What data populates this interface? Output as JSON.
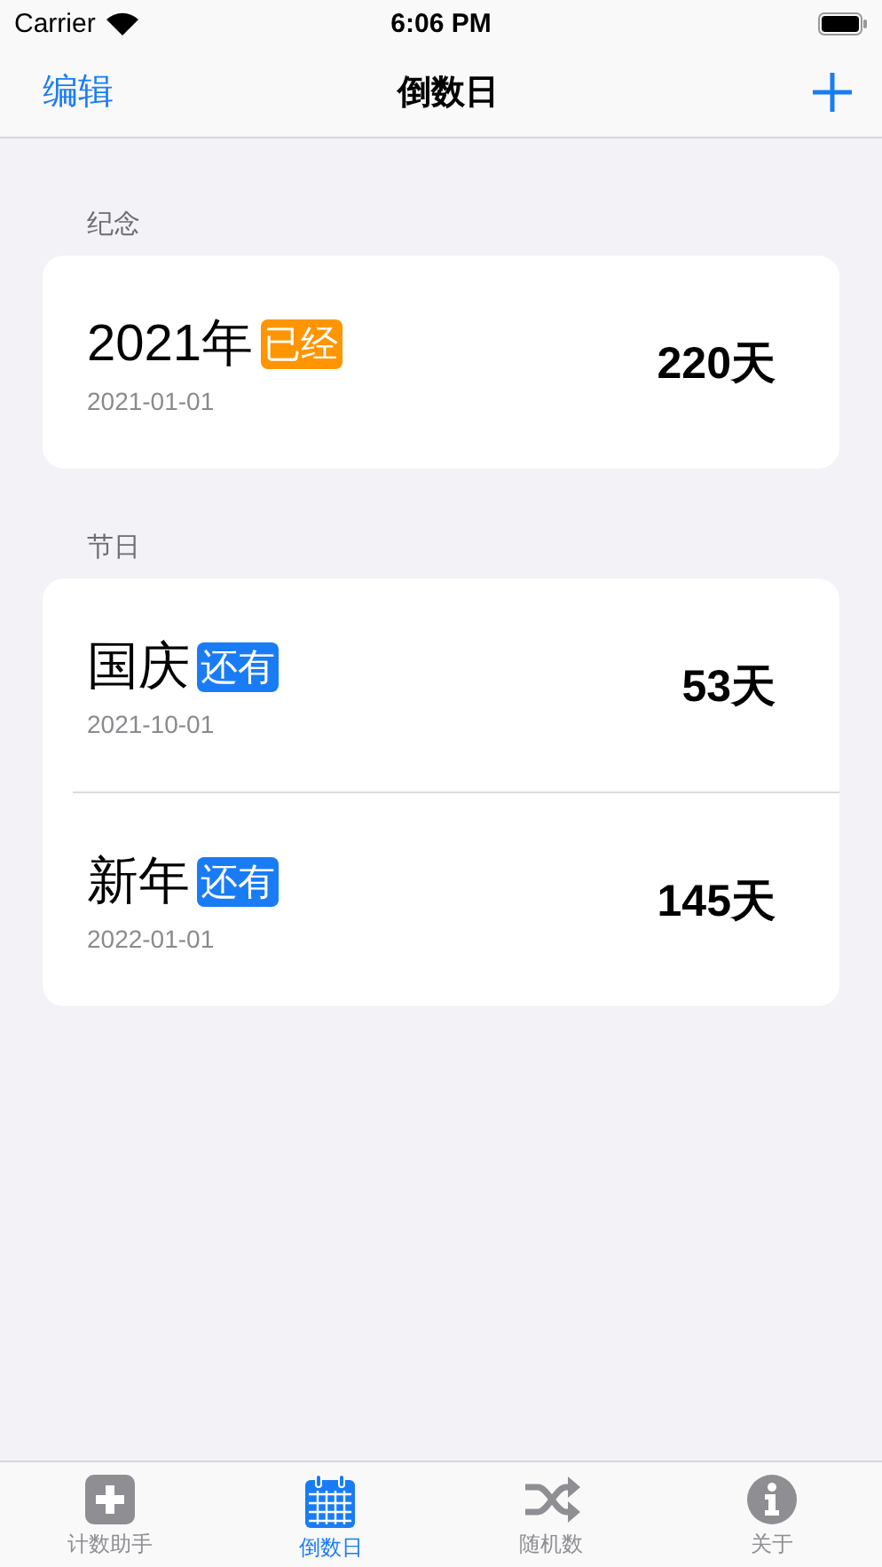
{
  "status_bar": {
    "carrier": "Carrier",
    "time": "6:06 PM"
  },
  "nav": {
    "left": "编辑",
    "title": "倒数日"
  },
  "sections": [
    {
      "header": "纪念",
      "items": [
        {
          "name": "2021年",
          "badge": "已经",
          "kind": "past",
          "date": "2021-01-01",
          "days": "220天"
        }
      ]
    },
    {
      "header": "节日",
      "items": [
        {
          "name": "国庆",
          "badge": "还有",
          "kind": "upcoming",
          "date": "2021-10-01",
          "days": "53天"
        },
        {
          "name": "新年",
          "badge": "还有",
          "kind": "upcoming",
          "date": "2022-01-01",
          "days": "145天"
        }
      ]
    }
  ],
  "tabs": [
    {
      "label": "计数助手",
      "kind": "plus",
      "selected": false
    },
    {
      "label": "倒数日",
      "kind": "calendar",
      "selected": true
    },
    {
      "label": "随机数",
      "kind": "shuffle",
      "selected": false
    },
    {
      "label": "关于",
      "kind": "info",
      "selected": false
    }
  ]
}
